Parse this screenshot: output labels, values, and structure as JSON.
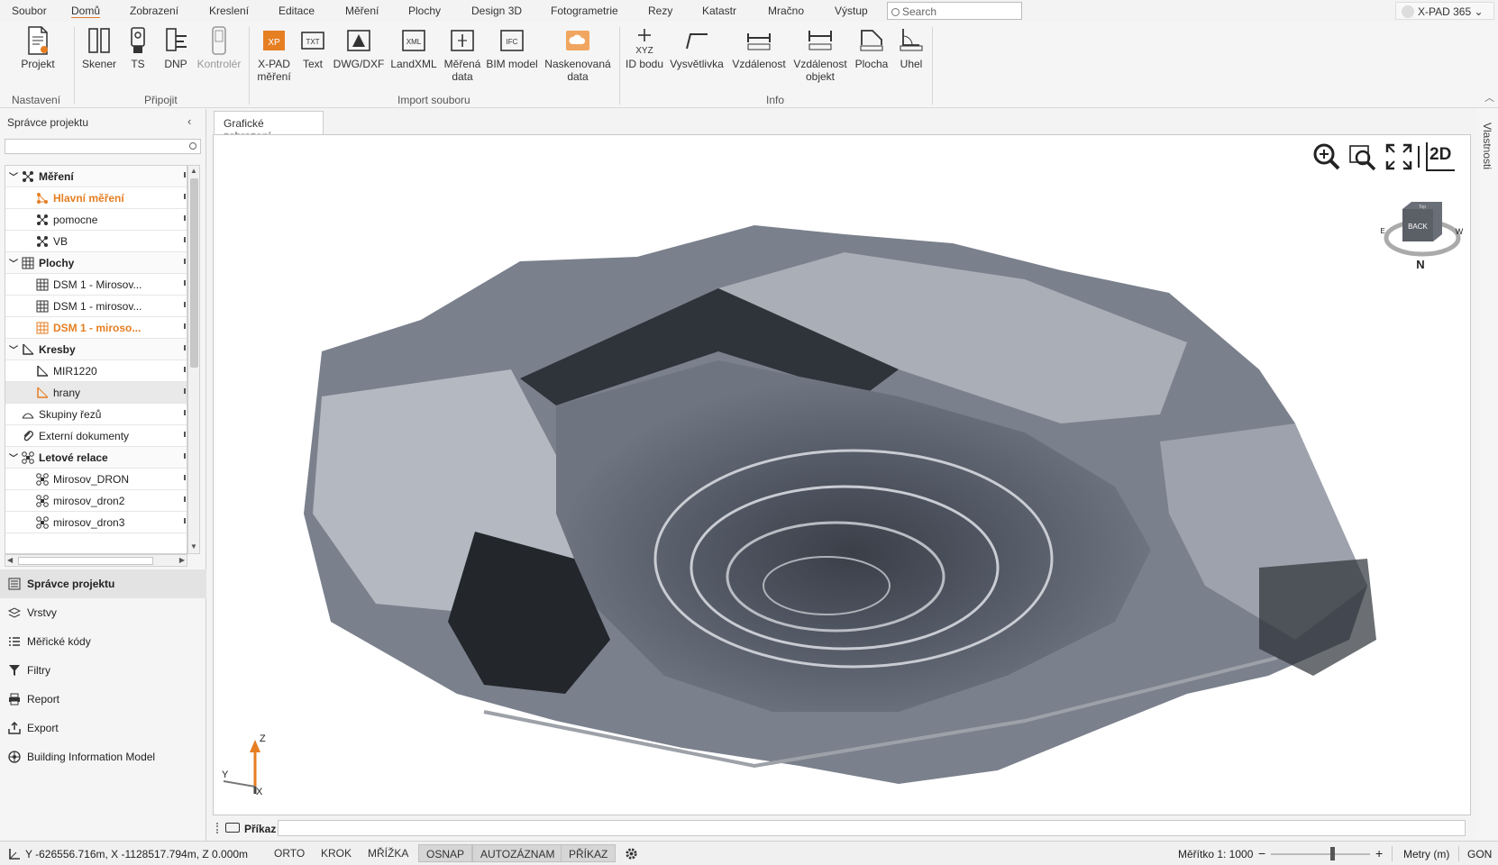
{
  "menu": {
    "items": [
      "Soubor",
      "Domů",
      "Zobrazení",
      "Kreslení",
      "Editace",
      "Měření",
      "Plochy",
      "Design 3D",
      "Fotogrametrie",
      "Rezy",
      "Katastr",
      "Mračno",
      "Výstup"
    ],
    "search_placeholder": "Search",
    "account": "X-PAD 365"
  },
  "ribbon": {
    "nastaveni": {
      "label": "Nastavení",
      "projekt": "Projekt"
    },
    "pripojit": {
      "label": "Připojit",
      "skener": "Skener",
      "ts": "TS",
      "dnp": "DNP",
      "kontroler": "Kontrolér"
    },
    "import": {
      "label": "Import souboru",
      "xpad_l1": "X-PAD",
      "xpad_l2": "měření",
      "text": "Text",
      "dwg": "DWG/DXF",
      "landxml": "LandXML",
      "merena_l1": "Měřená",
      "merena_l2": "data",
      "bim": "BIM model",
      "nask_l1": "Naskenovaná",
      "nask_l2": "data"
    },
    "info": {
      "label": "Info",
      "idbodu": "ID bodu",
      "vysvetlivka": "Vysvětlivka",
      "vzdalenost": "Vzdálenost",
      "vzdobj_l1": "Vzdálenost",
      "vzdobj_l2": "objekt",
      "plocha": "Plocha",
      "uhel": "Uhel",
      "xyz": "XYZ"
    }
  },
  "left_panel": {
    "title": "Správce projektu",
    "tree": [
      {
        "label": "Měření",
        "type": "cat"
      },
      {
        "label": "Hlavní měření",
        "type": "item",
        "style": "orange"
      },
      {
        "label": "pomocne",
        "type": "item"
      },
      {
        "label": "VB",
        "type": "item"
      },
      {
        "label": "Plochy",
        "type": "cat"
      },
      {
        "label": "DSM 1 - Mirosov...",
        "type": "item"
      },
      {
        "label": "DSM 1 - mirosov...",
        "type": "item"
      },
      {
        "label": "DSM 1 - miroso...",
        "type": "item",
        "style": "orange"
      },
      {
        "label": "Kresby",
        "type": "cat"
      },
      {
        "label": "MIR1220",
        "type": "item"
      },
      {
        "label": "hrany",
        "type": "item",
        "style": "selected"
      },
      {
        "label": "Skupiny řezů",
        "type": "plain"
      },
      {
        "label": "Externí dokumenty",
        "type": "plain"
      },
      {
        "label": "Letové relace",
        "type": "cat"
      },
      {
        "label": "Mirosov_DRON",
        "type": "item"
      },
      {
        "label": "mirosov_dron2",
        "type": "item"
      },
      {
        "label": "mirosov_dron3",
        "type": "item"
      }
    ],
    "nav": [
      "Správce projektu",
      "Vrstvy",
      "Měřické kódy",
      "Filtry",
      "Report",
      "Export",
      "Building Information Model"
    ]
  },
  "main": {
    "tab": "Grafické zobrazení",
    "view_mode": "2D",
    "navcube": {
      "face": "BACK",
      "top": "Top",
      "north": "N",
      "east": "E",
      "west": "W"
    },
    "axis": {
      "z": "Z",
      "y": "Y",
      "x": "X"
    },
    "command_label": "Příkaz",
    "properties": "Vlastnosti"
  },
  "status": {
    "coords": "Y -626556.716m, X -1128517.794m, Z 0.000m",
    "toggles": [
      {
        "label": "ORTO",
        "on": false
      },
      {
        "label": "KROK",
        "on": false
      },
      {
        "label": "MŘÍŽKA",
        "on": false
      },
      {
        "label": "OSNAP",
        "on": true
      },
      {
        "label": "AUTOZÁZNAM",
        "on": true
      },
      {
        "label": "PŘÍKAZ",
        "on": true
      }
    ],
    "scale": "Měřítko 1: 1000",
    "units": "Metry (m)",
    "angle": "GON",
    "minus": "−",
    "plus": "+"
  },
  "colors": {
    "accent": "#e67e22",
    "ribbon_bg": "#f5f5f5",
    "status_on": "#d6d6d6"
  }
}
